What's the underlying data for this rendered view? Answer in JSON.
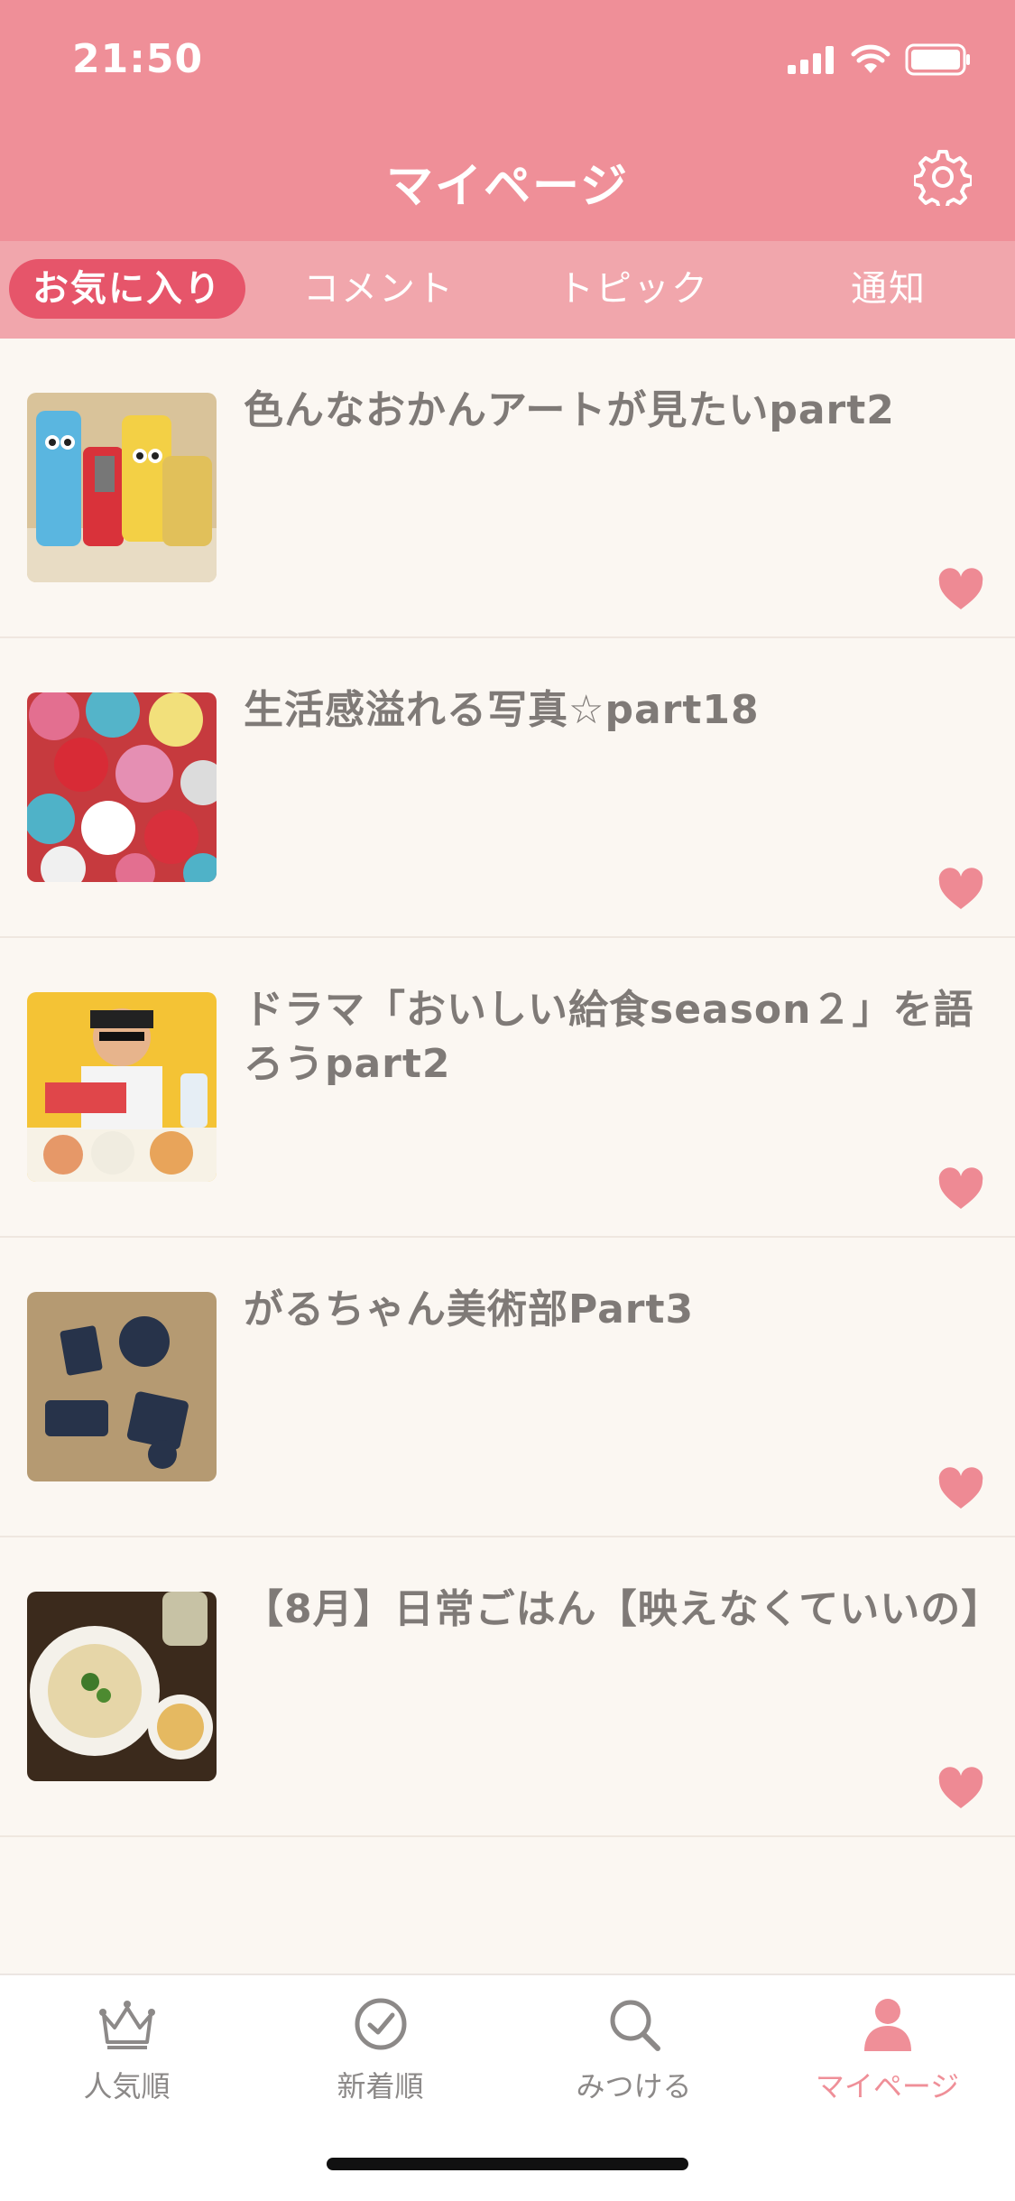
{
  "status": {
    "time": "21:50"
  },
  "header": {
    "title": "マイページ"
  },
  "tabs": [
    {
      "label": "お気に入り",
      "active": true
    },
    {
      "label": "コメント",
      "active": false
    },
    {
      "label": "トピック",
      "active": false
    },
    {
      "label": "通知",
      "active": false
    }
  ],
  "topics": [
    {
      "title": "色んなおかんアートが見たいpart2",
      "thumbnail": "knitted-cup-cozies"
    },
    {
      "title": "生活感溢れる写真☆part18",
      "thumbnail": "tissue-paper-flowers"
    },
    {
      "title": "ドラマ「おいしい給食season２」を語ろうpart2",
      "thumbnail": "drama-poster"
    },
    {
      "title": "がるちゃん美術部Part3",
      "thumbnail": "paper-cutouts"
    },
    {
      "title": "【8月】日常ごはん【映えなくていいの】",
      "thumbnail": "pasta-meal"
    }
  ],
  "bottom_nav": [
    {
      "label": "人気順",
      "icon": "crown-icon",
      "active": false
    },
    {
      "label": "新着順",
      "icon": "clock-check-icon",
      "active": false
    },
    {
      "label": "みつける",
      "icon": "search-icon",
      "active": false
    },
    {
      "label": "マイページ",
      "icon": "person-icon",
      "active": true
    }
  ],
  "colors": {
    "primary": "#ef8f98",
    "tab_bg": "#f1a6ac",
    "active_tab": "#e6556a",
    "background": "#fbf7f2",
    "heart": "#ee8a94"
  }
}
